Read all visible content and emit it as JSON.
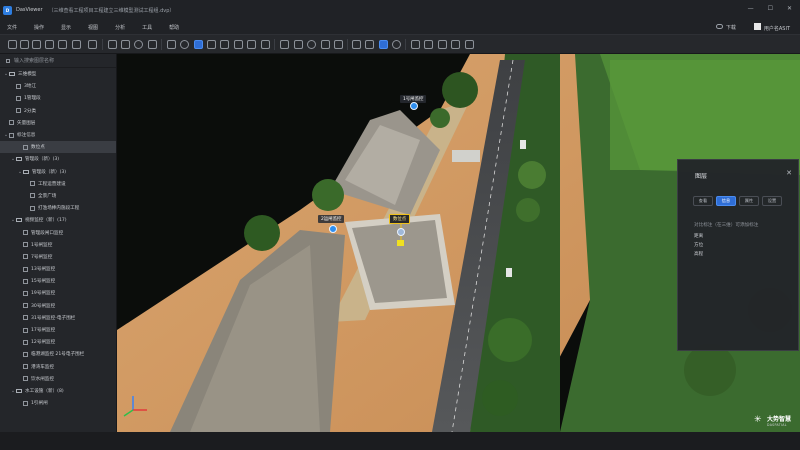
{
  "window": {
    "app_name": "DasViewer",
    "doc_path": "（三维查看工程项目工程建立三维模型测试工程组.dvp）",
    "controls": [
      "—",
      "☐",
      "✕"
    ]
  },
  "menu": {
    "items": [
      "文件",
      "操作",
      "显示",
      "视图",
      "分析",
      "工具",
      "帮助"
    ],
    "download_label": "下载",
    "user_label": "用户名ASIT"
  },
  "sidebar": {
    "header": "输入搜索图层名称",
    "tree": [
      {
        "label": "三维模型",
        "indent": 0,
        "chev": "⌄",
        "kind": "folder",
        "checked": false
      },
      {
        "label": "3地江",
        "indent": 1,
        "chev": "",
        "kind": "item",
        "checked": false
      },
      {
        "label": "1管理段",
        "indent": 1,
        "chev": "",
        "kind": "item",
        "checked": false
      },
      {
        "label": "2分类",
        "indent": 1,
        "chev": "",
        "kind": "item",
        "checked": false
      },
      {
        "label": "矢量图层",
        "indent": 0,
        "chev": "",
        "kind": "cb",
        "checked": false
      },
      {
        "label": "标注信息",
        "indent": 0,
        "chev": "⌄",
        "kind": "cb",
        "checked": false
      },
      {
        "label": "数位点",
        "indent": 2,
        "chev": "",
        "kind": "item",
        "checked": false,
        "selected": true
      },
      {
        "label": "管理段（新）(3)",
        "indent": 1,
        "chev": "⌄",
        "kind": "folder",
        "checked": false
      },
      {
        "label": "管理段（新）(3)",
        "indent": 2,
        "chev": "⌄",
        "kind": "folder",
        "checked": false
      },
      {
        "label": "工程运营建设",
        "indent": 3,
        "chev": "",
        "kind": "cb",
        "checked": false
      },
      {
        "label": "全景广场",
        "indent": 3,
        "chev": "",
        "kind": "cb",
        "checked": false
      },
      {
        "label": "打渔场棒内施段工程",
        "indent": 3,
        "chev": "",
        "kind": "cb",
        "checked": false
      },
      {
        "label": "视频监控（新）(17)",
        "indent": 1,
        "chev": "⌄",
        "kind": "folder",
        "checked": false
      },
      {
        "label": "管理段闸口监控",
        "indent": 2,
        "chev": "",
        "kind": "cb",
        "checked": false
      },
      {
        "label": "1号闸监控",
        "indent": 2,
        "chev": "",
        "kind": "cb",
        "checked": false
      },
      {
        "label": "7号闸监控",
        "indent": 2,
        "chev": "",
        "kind": "cb",
        "checked": false
      },
      {
        "label": "13号闸监控",
        "indent": 2,
        "chev": "",
        "kind": "cb",
        "checked": false
      },
      {
        "label": "15号闸监控",
        "indent": 2,
        "chev": "",
        "kind": "cb",
        "checked": false
      },
      {
        "label": "19号闸监控",
        "indent": 2,
        "chev": "",
        "kind": "cb",
        "checked": false
      },
      {
        "label": "30号闸监控",
        "indent": 2,
        "chev": "",
        "kind": "cb",
        "checked": false
      },
      {
        "label": "31号闸监控-电子围栏",
        "indent": 2,
        "chev": "",
        "kind": "cb",
        "checked": false
      },
      {
        "label": "17号闸监控",
        "indent": 2,
        "chev": "",
        "kind": "cb",
        "checked": false
      },
      {
        "label": "12号闸监控",
        "indent": 2,
        "chev": "",
        "kind": "cb",
        "checked": false
      },
      {
        "label": "临港湖监控 21号电子围栏",
        "indent": 2,
        "chev": "",
        "kind": "cb",
        "checked": false
      },
      {
        "label": "港湾车监控",
        "indent": 2,
        "chev": "",
        "kind": "cb",
        "checked": false
      },
      {
        "label": "饮水闸监控",
        "indent": 2,
        "chev": "",
        "kind": "cb",
        "checked": false
      },
      {
        "label": "水工设施（新）(8)",
        "indent": 1,
        "chev": "⌄",
        "kind": "folder",
        "checked": false
      },
      {
        "label": "1引闸闸",
        "indent": 2,
        "chev": "",
        "kind": "cb",
        "checked": false
      }
    ]
  },
  "map": {
    "labels": {
      "top": "1号闸监控",
      "mid": "2运闸监控",
      "highlight": "数位点"
    }
  },
  "panel": {
    "title": "图层",
    "close": "✕",
    "tabs": [
      "查看",
      "信息",
      "属性",
      "设置"
    ],
    "desc": "对比标注（在三维）可添加标注",
    "fields": [
      "距离",
      "方位",
      "高程"
    ]
  },
  "brand": {
    "name": "大势智慧",
    "sub": "DASPATIAL"
  }
}
